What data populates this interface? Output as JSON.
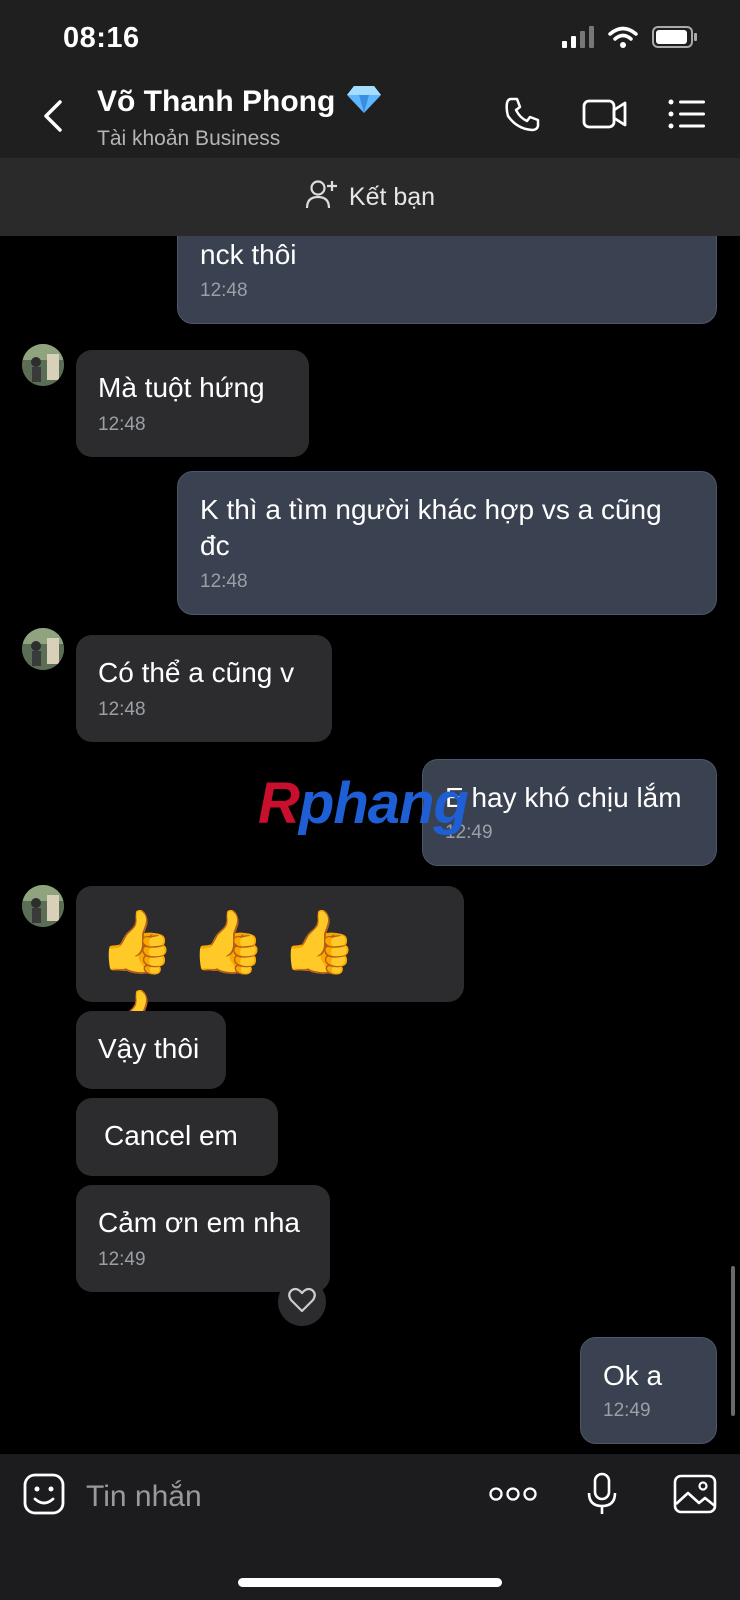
{
  "status_bar": {
    "time": "08:16"
  },
  "header": {
    "contact_name": "Võ Thanh Phong",
    "contact_sub": "Tài khoản Business",
    "icons": [
      "back-chevron-icon",
      "diamond-badge-icon",
      "phone-icon",
      "video-call-icon",
      "menu-list-icon"
    ]
  },
  "friend_bar": {
    "label": "Kết bạn",
    "icon": "add-friend-icon"
  },
  "messages": [
    {
      "direction": "out",
      "text": "nck thôi",
      "time": "12:48"
    },
    {
      "direction": "in",
      "text": "Mà tuột hứng",
      "time": "12:48"
    },
    {
      "direction": "out",
      "text": "K thì a tìm người khác hợp vs a cũng đc",
      "time": "12:48"
    },
    {
      "direction": "in",
      "text": "Có thể a cũng v",
      "time": "12:48"
    },
    {
      "direction": "out",
      "text": "E hay khó chịu lắm",
      "time": "12:49"
    },
    {
      "direction": "in",
      "text": "👍👍👍👍"
    },
    {
      "direction": "in",
      "text": "Vậy thôi"
    },
    {
      "direction": "in",
      "text": "Cancel em"
    },
    {
      "direction": "in",
      "text": "Cảm ơn em nha",
      "time": "12:49"
    },
    {
      "direction": "out",
      "text": "Ok a",
      "time": "12:49"
    }
  ],
  "watermark": {
    "text_first": "R",
    "text_rest": "phang"
  },
  "composer": {
    "placeholder": "Tin nhắn",
    "icons": [
      "sticker-icon",
      "more-icon",
      "microphone-icon",
      "image-icon"
    ]
  },
  "colors": {
    "background": "#000000",
    "header": "#1f1f1f",
    "incoming_bubble": "#2c2c2e",
    "outgoing_bubble": "#3a4150",
    "timestamp": "#9aa0a6"
  }
}
